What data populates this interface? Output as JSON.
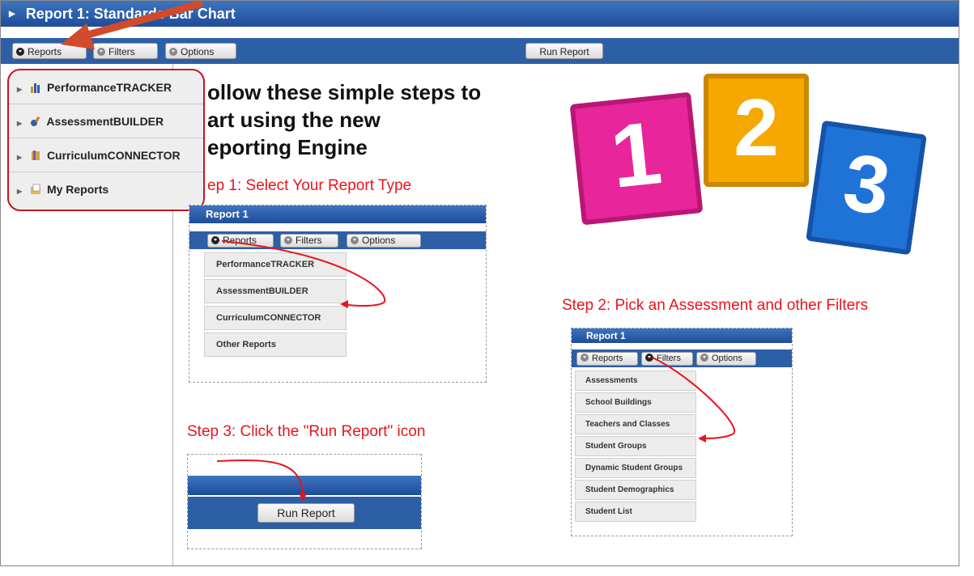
{
  "window": {
    "title": "Report 1: Standards Bar Chart"
  },
  "toolbar": {
    "reports": "Reports",
    "filters": "Filters",
    "options": "Options",
    "run_report": "Run Report"
  },
  "reports_menu": [
    "PerformanceTRACKER",
    "AssessmentBUILDER",
    "CurriculumCONNECTOR",
    "My Reports"
  ],
  "intro": {
    "line1": "ollow these simple steps to",
    "line2": "art using the new",
    "line3": "eporting Engine"
  },
  "steps": {
    "step1": "ep 1:  Select Your Report Type",
    "step2": "Step 2:  Pick an Assessment and other Filters",
    "step3": "Step 3:  Click the \"Run Report\" icon"
  },
  "shot1": {
    "title": "Report 1",
    "buttons": [
      "Reports",
      "Filters",
      "Options"
    ],
    "items": [
      "PerformanceTRACKER",
      "AssessmentBUILDER",
      "CurriculumCONNECTOR",
      "Other Reports"
    ]
  },
  "shot2": {
    "title": "Report 1",
    "buttons": [
      "Reports",
      "Filters",
      "Options"
    ],
    "items": [
      "Assessments",
      "School Buildings",
      "Teachers and Classes",
      "Student Groups",
      "Dynamic Student Groups",
      "Student Demographics",
      "Student List"
    ]
  },
  "shot3": {
    "button": "Run Report"
  },
  "cubes": [
    {
      "label": "1",
      "color": "#e8259a"
    },
    {
      "label": "2",
      "color": "#f4a800"
    },
    {
      "label": "3",
      "color": "#1f72d6"
    }
  ],
  "colors": {
    "header": "#2d5fa6",
    "step_text": "#e8141c",
    "menu_highlight": "#c8141e"
  }
}
